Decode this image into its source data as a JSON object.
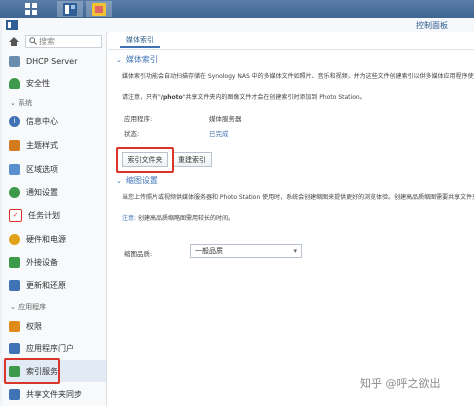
{
  "window": {
    "title": "控制面板"
  },
  "search": {
    "placeholder": "搜索"
  },
  "sidebar": {
    "items_top": [
      {
        "label": "DHCP Server",
        "icon": "dhcp-icon",
        "color": "#6a8caf"
      },
      {
        "label": "安全性",
        "icon": "security-icon",
        "color": "#3c9a4a"
      }
    ],
    "section_system": "系统",
    "items_system": [
      {
        "label": "信息中心",
        "icon": "info-icon",
        "color": "#3f73b5"
      },
      {
        "label": "主题样式",
        "icon": "theme-icon",
        "color": "#d47a1f"
      },
      {
        "label": "区域选项",
        "icon": "region-icon",
        "color": "#5a8fcf"
      },
      {
        "label": "通知设置",
        "icon": "notification-icon",
        "color": "#3c9a4a"
      },
      {
        "label": "任务计划",
        "icon": "task-icon",
        "color": "#d9352b"
      },
      {
        "label": "硬件和电源",
        "icon": "hardware-icon",
        "color": "#e0a21a"
      },
      {
        "label": "外接设备",
        "icon": "external-device-icon",
        "color": "#3c9a4a"
      },
      {
        "label": "更新和还原",
        "icon": "update-icon",
        "color": "#3f73b5"
      }
    ],
    "section_apps": "应用程序",
    "items_apps": [
      {
        "label": "权限",
        "icon": "permission-icon",
        "color": "#e08a1a"
      },
      {
        "label": "应用程序门户",
        "icon": "portal-icon",
        "color": "#3f73b5"
      },
      {
        "label": "索引服务",
        "icon": "index-icon",
        "color": "#3c9a4a"
      },
      {
        "label": "共享文件夹同步",
        "icon": "sync-icon",
        "color": "#3f73b5"
      }
    ]
  },
  "main": {
    "tab": "媒体索引",
    "media_index": {
      "heading": "媒体索引",
      "desc": "媒体索引功能会自动扫描存储在 Synology NAS 中的多媒体文件如照片、音乐和视频，并为这些文件创建索引以供多媒体应用程序使用。",
      "note_prefix": "请注意，只有\"",
      "note_bold": "/photo",
      "note_suffix": "\"共享文件夹内的图像文件才会在创建索引时添加到 Photo Station。",
      "app_label": "应用程序:",
      "app_value": "媒体服务器",
      "status_label": "状态:",
      "status_value": "已完成",
      "btn_index_folder": "索引文件夹",
      "btn_reindex": "重建索引"
    },
    "thumbnail": {
      "heading": "缩图设置",
      "desc": "当您上传照片或视频供媒体服务器和 Photo Station 使用时，系统会创建缩图来提供更好的浏览体验。创建高品质缩图需要共享文件夹",
      "note_label": "注意:",
      "note_text": "创建高品质缩略图需用较长的时间。",
      "quality_label": "缩图品质:",
      "quality_value": "一般品质"
    }
  },
  "watermark": "知乎 @呼之欲出"
}
